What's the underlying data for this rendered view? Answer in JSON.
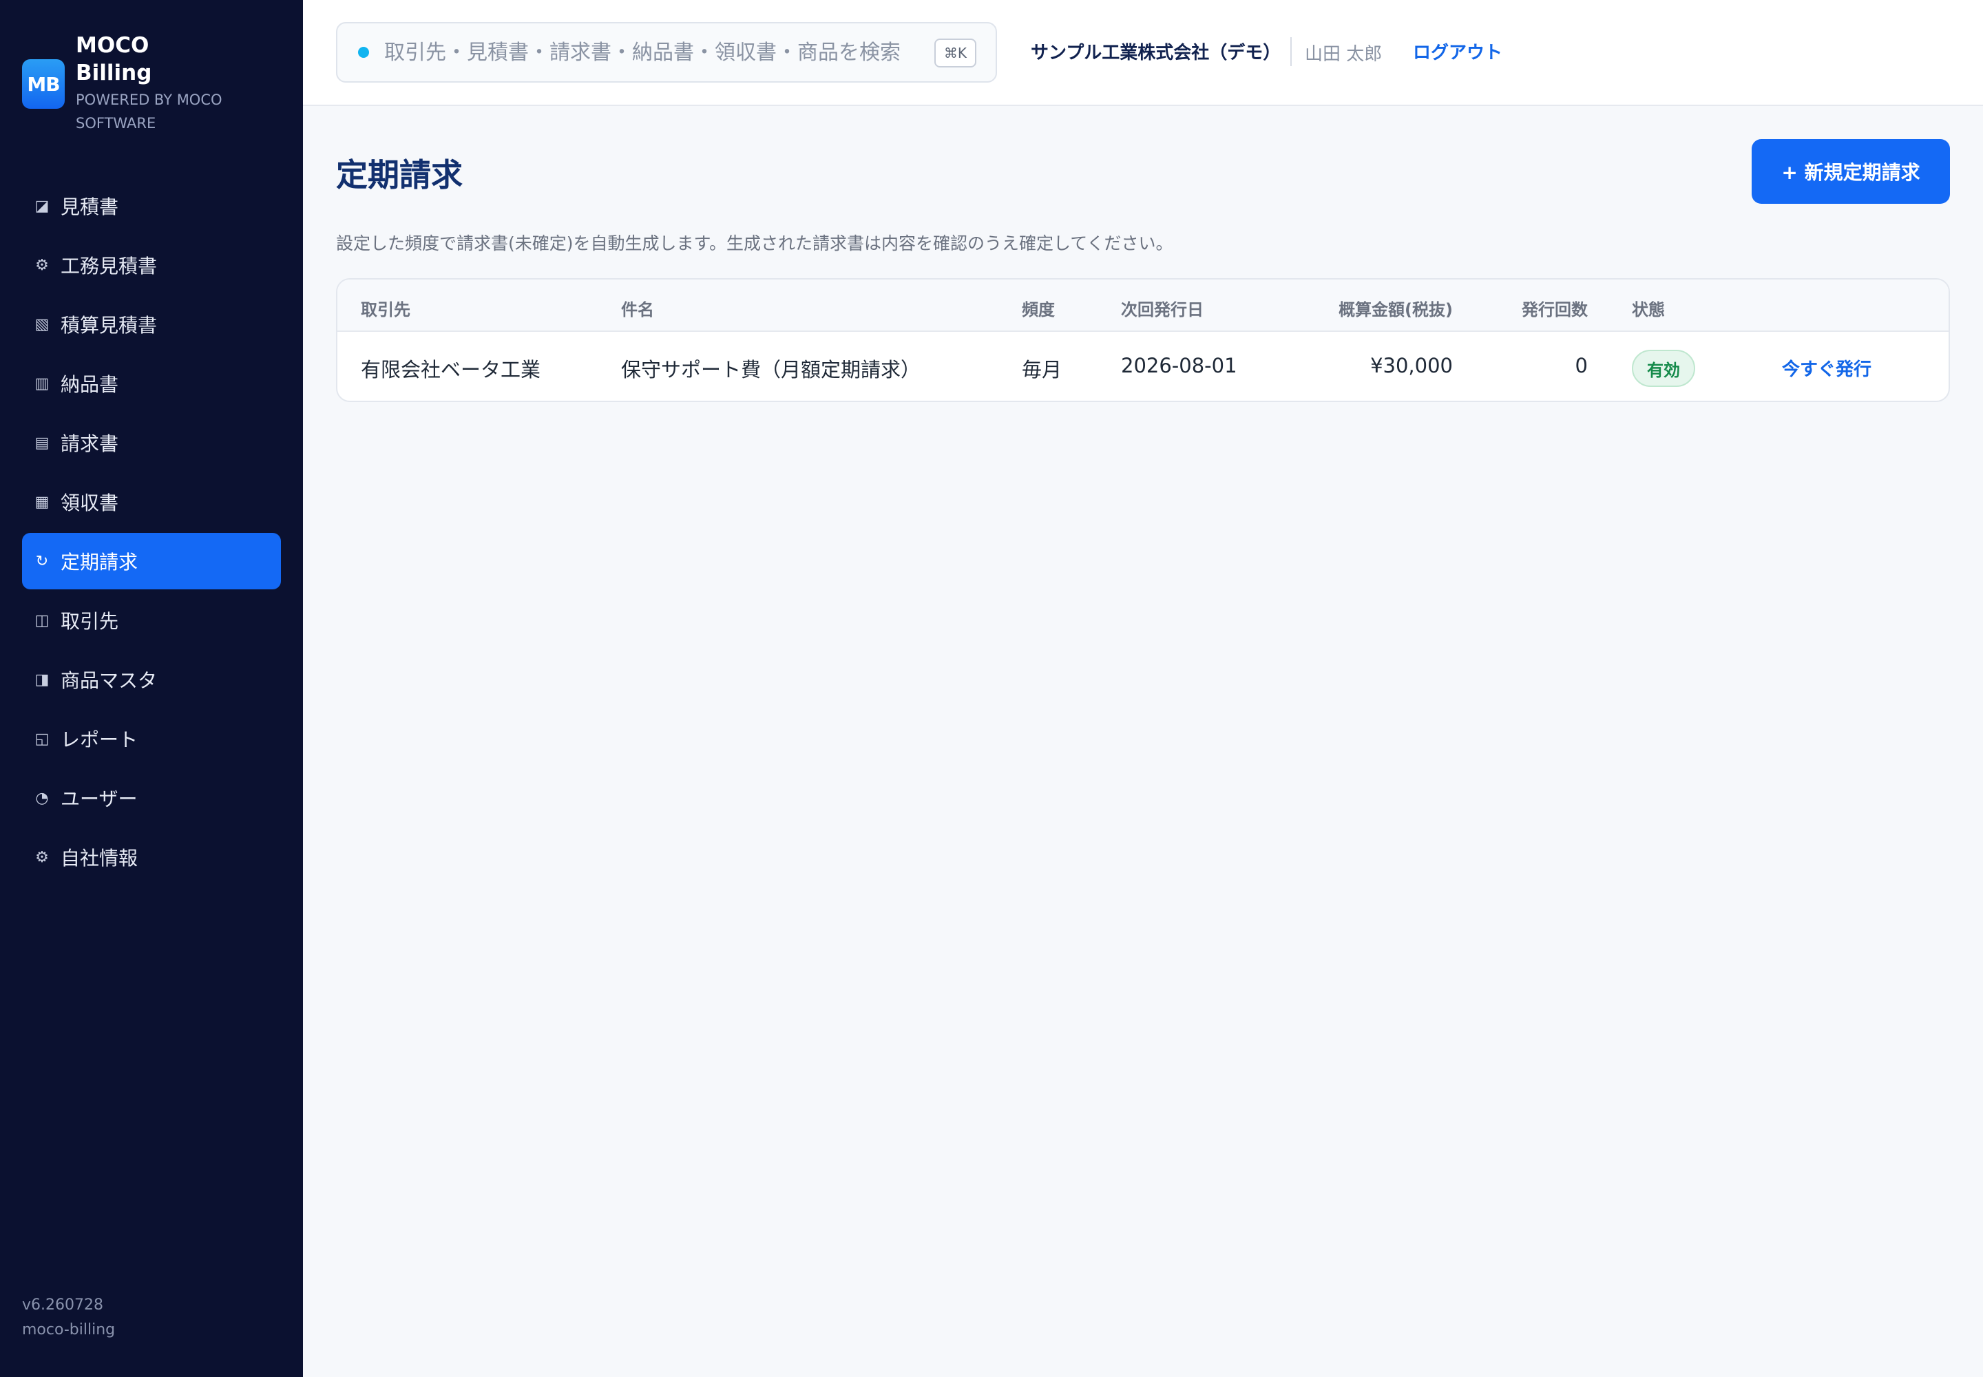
{
  "brand": {
    "logo": "MB",
    "name": "MOCO Billing",
    "powered": "POWERED BY MOCO SOFTWARE"
  },
  "sidebar": {
    "items": [
      {
        "label": "見積書",
        "icon": "half-square-icon",
        "glyph": "◪"
      },
      {
        "label": "工務見積書",
        "icon": "gear-icon",
        "glyph": "⚙"
      },
      {
        "label": "積算見積書",
        "icon": "hatched-square-icon",
        "glyph": "▧"
      },
      {
        "label": "納品書",
        "icon": "columns-icon",
        "glyph": "▥"
      },
      {
        "label": "請求書",
        "icon": "lines-square-icon",
        "glyph": "▤"
      },
      {
        "label": "領収書",
        "icon": "grid-square-icon",
        "glyph": "▦"
      },
      {
        "label": "定期請求",
        "icon": "refresh-icon",
        "glyph": "↻",
        "active": true
      },
      {
        "label": "取引先",
        "icon": "book-icon",
        "glyph": "◫"
      },
      {
        "label": "商品マスタ",
        "icon": "half-box-icon",
        "glyph": "◨"
      },
      {
        "label": "レポート",
        "icon": "report-icon",
        "glyph": "◱"
      },
      {
        "label": "ユーザー",
        "icon": "pie-icon",
        "glyph": "◔"
      },
      {
        "label": "自社情報",
        "icon": "cog-icon",
        "glyph": "⚙"
      }
    ]
  },
  "footer": {
    "version": "v6.260728",
    "app_id": "moco-billing"
  },
  "header": {
    "search_placeholder": "取引先・見積書・請求書・納品書・領収書・商品を検索",
    "shortcut": "⌘K",
    "company": "サンプル工業株式会社（デモ）",
    "user": "山田 太郎",
    "logout": "ログアウト"
  },
  "main": {
    "title": "定期請求",
    "new_button": "+ 新規定期請求",
    "description": "設定した頻度で請求書(未確定)を自動生成します。生成された請求書は内容を確認のうえ確定してください。"
  },
  "table": {
    "columns": [
      "取引先",
      "件名",
      "頻度",
      "次回発行日",
      "概算金額(税抜)",
      "発行回数",
      "状態"
    ],
    "rows": [
      {
        "client": "有限会社ベータ工業",
        "subject": "保守サポート費（月額定期請求）",
        "frequency": "毎月",
        "next_date": "2026-08-01",
        "amount": "¥30,000",
        "count": "0",
        "status": "有効",
        "action": "今すぐ発行"
      }
    ]
  },
  "colors": {
    "sidebar_bg": "#0b1130",
    "accent": "#1469f5",
    "title": "#12306f",
    "status_active": "#148a4a"
  }
}
